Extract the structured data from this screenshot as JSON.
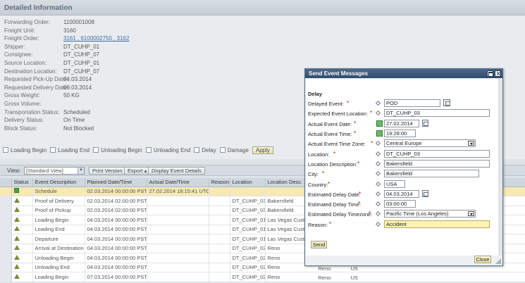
{
  "header": {
    "title": "Detailed Information"
  },
  "info": [
    {
      "label": "Forwarding Order:",
      "value": "1100001008",
      "link": false
    },
    {
      "label": "Freight Unit:",
      "value": "3160",
      "link": false
    },
    {
      "label": "Freight Order:",
      "value": "3161 , 6100002750 , 3162",
      "link": true
    },
    {
      "label": "Shipper:",
      "value": "DT_CUHP_01",
      "link": false
    },
    {
      "label": "Consignee:",
      "value": "DT_CUHP_07",
      "link": false
    },
    {
      "label": "Source Location:",
      "value": "DT_CUHP_01",
      "link": false
    },
    {
      "label": "Destination Location:",
      "value": "DT_CUHP_07",
      "link": false
    },
    {
      "label": "Requested Pick-Up Date:",
      "value": "04.03.2014",
      "link": false
    },
    {
      "label": "Requested Delivery Date:",
      "value": "09.03.2014",
      "link": false
    },
    {
      "label": "Gross Weight:",
      "value": "50 KG",
      "link": false
    },
    {
      "label": "Gross Volume:",
      "value": "",
      "link": false
    },
    {
      "label": "Transportation Status:",
      "value": "Scheduled",
      "link": false
    },
    {
      "label": "Delivery Status:",
      "value": "On Time",
      "link": false
    },
    {
      "label": "Block Status:",
      "value": "Not Blocked",
      "link": false
    }
  ],
  "filters": {
    "items": [
      "Loading Begin",
      "Loading End",
      "Unloading Begin",
      "Unloading End",
      "Delay",
      "Damage"
    ],
    "apply_label": "Apply"
  },
  "toolbar": {
    "view_label": "View:",
    "view_value": "[Standard View]",
    "print_label": "Print Version",
    "export_label": "Export ▴",
    "details_label": "Display Event Details"
  },
  "table": {
    "columns": [
      "",
      "Status",
      "Event Description",
      "Planned Date/Time",
      "Actual Date/Time",
      "Reason",
      "Location",
      "Location Desc."
    ],
    "rows": [
      {
        "status": "ok",
        "desc": "Schedule",
        "planned": "02.03.2014 00:00:00 PST",
        "actual": "27.02.2014 18:15:41 UTC",
        "reason": "",
        "loc": "",
        "locdesc": "",
        "extra1": "",
        "extra2": ""
      },
      {
        "status": "warn",
        "desc": "Proof of Delivery",
        "planned": "02.03.2014 02:00:00 PST",
        "actual": "",
        "reason": "",
        "loc": "DT_CUHP_03",
        "locdesc": "Bakersfield",
        "extra1": "",
        "extra2": ""
      },
      {
        "status": "warn",
        "desc": "Proof of Pickup",
        "planned": "02.03.2014 02:00:00 PST",
        "actual": "",
        "reason": "",
        "loc": "DT_CUHP_03",
        "locdesc": "Bakersfield",
        "extra1": "",
        "extra2": ""
      },
      {
        "status": "warn",
        "desc": "Loading Begin",
        "planned": "04.03.2014 00:00:00 PST",
        "actual": "",
        "reason": "",
        "loc": "DT_CUHP_01",
        "locdesc": "Las Vegas Cust",
        "extra1": "",
        "extra2": ""
      },
      {
        "status": "warn",
        "desc": "Loading End",
        "planned": "04.03.2014 00:00:00 PST",
        "actual": "",
        "reason": "",
        "loc": "DT_CUHP_01",
        "locdesc": "Las Vegas Cust",
        "extra1": "",
        "extra2": ""
      },
      {
        "status": "warn",
        "desc": "Departure",
        "planned": "04.03.2014 00:00:00 PST",
        "actual": "",
        "reason": "",
        "loc": "DT_CUHP_01",
        "locdesc": "Las Vegas Cust",
        "extra1": "",
        "extra2": ""
      },
      {
        "status": "warn",
        "desc": "Arrival at Destination",
        "planned": "04.03.2014 00:00:00 PST",
        "actual": "",
        "reason": "",
        "loc": "DT_CUHP_02",
        "locdesc": "Reno",
        "extra1": "",
        "extra2": ""
      },
      {
        "status": "warn",
        "desc": "Unloading Begin",
        "planned": "04.03.2014 00:00:00 PST",
        "actual": "",
        "reason": "",
        "loc": "DT_CUHP_02",
        "locdesc": "Reno",
        "extra1": "",
        "extra2": ""
      },
      {
        "status": "warn",
        "desc": "Unloading End",
        "planned": "04.03.2014 00:00:00 PST",
        "actual": "",
        "reason": "",
        "loc": "DT_CUHP_02",
        "locdesc": "Reno",
        "extra1": "Reno",
        "extra2": "US"
      },
      {
        "status": "warn",
        "desc": "Loading Begin",
        "planned": "07.03.2014 00:00:00 PST",
        "actual": "",
        "reason": "",
        "loc": "DT_CUHP_02",
        "locdesc": "Reno",
        "extra1": "Reno",
        "extra2": "US"
      }
    ]
  },
  "dialog": {
    "title": "Send Event Messages",
    "section": "Delay",
    "fields": [
      {
        "label": "Delayed Event:",
        "value": "POD"
      },
      {
        "label": "Expected Event Location:",
        "value": "DT_CUHP_03"
      },
      {
        "label": "Actual Event Date:",
        "value": "27.02.2014"
      },
      {
        "label": "Actual Event Time:",
        "value": "19:28:00"
      },
      {
        "label": "Actual Event Time Zone:",
        "value": "Central Europe"
      },
      {
        "label": "Location:",
        "value": "DT_CUHP_03"
      },
      {
        "label": "Location Description:",
        "value": "Bakersfield"
      },
      {
        "label": "City:",
        "value": "Bakersfield"
      },
      {
        "label": "Country:",
        "value": "USA"
      },
      {
        "label": "Estimated Delay Date:",
        "value": "04.03.2014"
      },
      {
        "label": "Estimated Delay Time:",
        "value": "03:00:00"
      },
      {
        "label": "Estimated Delay Timezone:",
        "value": "Pacific Time (Los Angeles)"
      },
      {
        "label": "Reason:",
        "value": "Accident"
      }
    ],
    "required_mark": "*",
    "send_label": "Send",
    "close_label": "Close"
  }
}
